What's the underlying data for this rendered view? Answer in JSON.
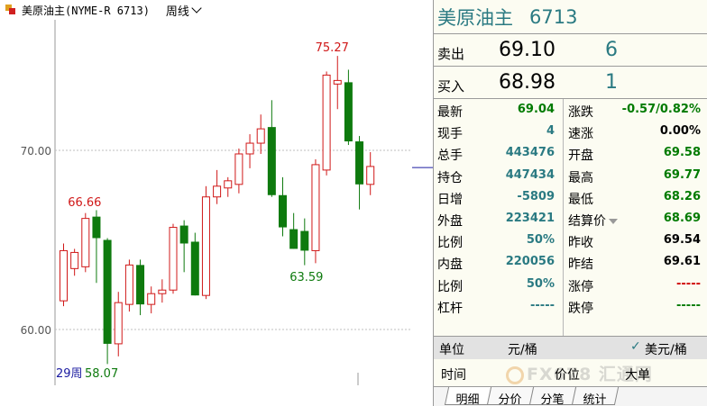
{
  "header": {
    "title": "美原油主(NYME-R 6713)",
    "period": "周线"
  },
  "colors": {
    "up": "#d01818",
    "down": "#0e7a0e",
    "grid": "#bfbfbf",
    "axis_text": "#555555",
    "teal": "#2a7a82"
  },
  "chart_data": {
    "type": "candlestick",
    "y_ticks": [
      {
        "value": 70,
        "label": "70.00"
      },
      {
        "value": 60,
        "label": "60.00"
      }
    ],
    "candles": [
      {
        "o": 61.6,
        "h": 64.8,
        "l": 61.3,
        "c": 64.4
      },
      {
        "o": 63.4,
        "h": 64.5,
        "l": 63.0,
        "c": 64.3
      },
      {
        "o": 63.5,
        "h": 66.5,
        "l": 63.2,
        "c": 66.2
      },
      {
        "o": 66.3,
        "h": 66.66,
        "l": 62.6,
        "c": 65.1
      },
      {
        "o": 65.0,
        "h": 65.1,
        "l": 58.07,
        "c": 59.2
      },
      {
        "o": 59.2,
        "h": 62.1,
        "l": 58.5,
        "c": 61.5
      },
      {
        "o": 61.4,
        "h": 63.9,
        "l": 61.0,
        "c": 63.6
      },
      {
        "o": 63.6,
        "h": 63.9,
        "l": 60.8,
        "c": 61.4
      },
      {
        "o": 61.4,
        "h": 62.4,
        "l": 60.9,
        "c": 62.0
      },
      {
        "o": 62.0,
        "h": 62.8,
        "l": 61.5,
        "c": 62.2
      },
      {
        "o": 62.2,
        "h": 65.9,
        "l": 62.0,
        "c": 65.7
      },
      {
        "o": 65.8,
        "h": 66.1,
        "l": 63.2,
        "c": 64.8
      },
      {
        "o": 64.9,
        "h": 65.4,
        "l": 61.9,
        "c": 61.9
      },
      {
        "o": 61.9,
        "h": 68.0,
        "l": 61.7,
        "c": 67.4
      },
      {
        "o": 67.4,
        "h": 68.9,
        "l": 67.0,
        "c": 68.0
      },
      {
        "o": 67.9,
        "h": 68.5,
        "l": 67.4,
        "c": 68.3
      },
      {
        "o": 68.1,
        "h": 70.1,
        "l": 67.6,
        "c": 69.8
      },
      {
        "o": 69.8,
        "h": 70.9,
        "l": 69.0,
        "c": 70.4
      },
      {
        "o": 70.4,
        "h": 72.0,
        "l": 69.8,
        "c": 71.2
      },
      {
        "o": 71.3,
        "h": 72.8,
        "l": 67.4,
        "c": 67.5
      },
      {
        "o": 67.5,
        "h": 68.5,
        "l": 65.2,
        "c": 65.7
      },
      {
        "o": 65.6,
        "h": 66.5,
        "l": 64.5,
        "c": 64.5
      },
      {
        "o": 65.5,
        "h": 66.2,
        "l": 63.59,
        "c": 64.4
      },
      {
        "o": 64.4,
        "h": 69.5,
        "l": 63.7,
        "c": 69.2
      },
      {
        "o": 68.9,
        "h": 74.4,
        "l": 68.6,
        "c": 74.2
      },
      {
        "o": 73.7,
        "h": 75.27,
        "l": 72.3,
        "c": 73.9
      },
      {
        "o": 73.8,
        "h": 74.5,
        "l": 70.3,
        "c": 70.5
      },
      {
        "o": 70.5,
        "h": 70.8,
        "l": 66.7,
        "c": 68.1
      },
      {
        "o": 68.1,
        "h": 69.9,
        "l": 67.5,
        "c": 69.1
      }
    ],
    "annotations": {
      "high": "75.27",
      "high_left": "66.66",
      "low_mid": "63.59",
      "low_bottom": "58.07",
      "period_count": "29周"
    },
    "last_price_marker": 69.04
  },
  "quote": {
    "name": "美原油主",
    "code": "6713",
    "sell_label": "卖出",
    "sell_price": "69.10",
    "sell_vol": "6",
    "buy_label": "买入",
    "buy_price": "68.98",
    "buy_vol": "1",
    "left_rows": [
      {
        "label": "最新",
        "value": "69.04",
        "color": "green"
      },
      {
        "label": "现手",
        "value": "4",
        "color": "teal"
      },
      {
        "label": "总手",
        "value": "443476",
        "color": "teal"
      },
      {
        "label": "持仓",
        "value": "447434",
        "color": "teal"
      },
      {
        "label": "日增",
        "value": "-5809",
        "color": "teal"
      },
      {
        "label": "外盘",
        "value": "223421",
        "color": "teal"
      },
      {
        "label": "比例",
        "value": "50%",
        "color": "teal"
      },
      {
        "label": "内盘",
        "value": "220056",
        "color": "teal"
      },
      {
        "label": "比例",
        "value": "50%",
        "color": "teal"
      },
      {
        "label": "杠杆",
        "value": "-----",
        "color": "teal"
      }
    ],
    "right_rows": [
      {
        "label": "涨跌",
        "value": "-0.57/0.82%",
        "color": "green"
      },
      {
        "label": "速涨",
        "value": "0.00%",
        "color": "black"
      },
      {
        "label": "开盘",
        "value": "69.58",
        "color": "green"
      },
      {
        "label": "最高",
        "value": "69.77",
        "color": "green"
      },
      {
        "label": "最低",
        "value": "68.26",
        "color": "green"
      },
      {
        "label": "结算价",
        "value": "68.69",
        "color": "green"
      },
      {
        "label": "昨收",
        "value": "69.54",
        "color": "black"
      },
      {
        "label": "昨结",
        "value": "69.61",
        "color": "black"
      },
      {
        "label": "涨停",
        "value": "-----",
        "color": "red"
      },
      {
        "label": "跌停",
        "value": "-----",
        "color": "green"
      }
    ],
    "unit_label": "单位",
    "unit_value": "元/桶",
    "unit_check": "✓",
    "unit_value2": "美元/桶",
    "tick_headers": [
      "时间",
      "价位",
      "大单"
    ],
    "watermark": "FX678 汇通网",
    "tabs": [
      "明细",
      "分价",
      "分笔",
      "统计"
    ]
  }
}
